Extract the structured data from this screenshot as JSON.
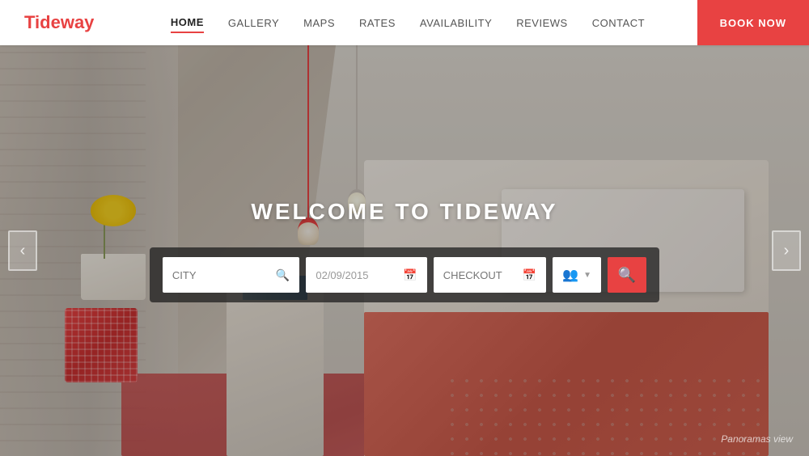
{
  "header": {
    "logo": "Tideway",
    "nav": [
      {
        "label": "HOME",
        "active": true
      },
      {
        "label": "GALLERY",
        "active": false
      },
      {
        "label": "MAPS",
        "active": false
      },
      {
        "label": "RATES",
        "active": false
      },
      {
        "label": "AVAILABILITY",
        "active": false
      },
      {
        "label": "REVIEWS",
        "active": false
      },
      {
        "label": "CONTACT",
        "active": false
      }
    ],
    "book_now": "BOOK NOW"
  },
  "hero": {
    "title": "WELCOME TO TIDEWAY",
    "search": {
      "city_placeholder": "CITY",
      "checkin_value": "02/09/2015",
      "checkout_placeholder": "CHECKOUT",
      "panoramas_label": "Panoramas view"
    }
  },
  "colors": {
    "brand_red": "#e84242",
    "nav_active": "#222",
    "nav_normal": "#555"
  }
}
